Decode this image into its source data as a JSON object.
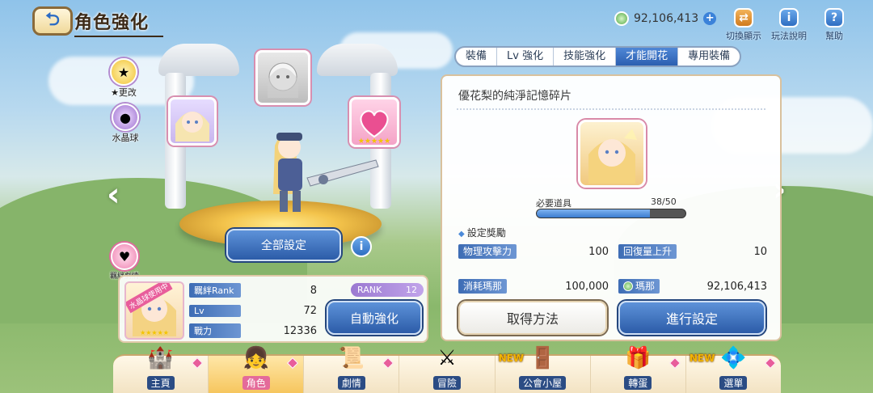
{
  "header": {
    "back_icon": "back-arrow-icon",
    "title": "角色強化",
    "currency": {
      "icon": "mana-coin-icon",
      "amount": "92,106,413"
    },
    "buttons": [
      {
        "icon": "switch-icon",
        "label": "切換顯示"
      },
      {
        "icon": "info-icon",
        "label": "玩法說明"
      },
      {
        "icon": "help-icon",
        "label": "幫助"
      }
    ]
  },
  "tabs": [
    {
      "label": "裝備"
    },
    {
      "label": "Lv 強化"
    },
    {
      "label": "技能強化"
    },
    {
      "label": "才能開花",
      "active": true
    },
    {
      "label": "專用裝備"
    }
  ],
  "left": {
    "side_icons": [
      {
        "icon": "star-change-icon",
        "label": "★更改"
      },
      {
        "icon": "crystal-ball-icon",
        "label": "水晶球"
      },
      {
        "icon": "heart-bond-icon",
        "label": "羈絆劇情"
      }
    ],
    "set_all_label": "全部設定",
    "status": {
      "crystal_tag": "水晶球使用中",
      "rows": [
        {
          "label": "羈絆Rank",
          "value": "8"
        },
        {
          "label": "Lv",
          "value": "72"
        },
        {
          "label": "戰力",
          "value": "12336"
        }
      ],
      "rank": {
        "label": "RANK",
        "value": "12"
      },
      "auto_enhance_label": "自動強化"
    }
  },
  "panel": {
    "item_title": "優花梨的純淨記憶碎片",
    "required_label": "必要道具",
    "required_count": "38/50",
    "progress": 0.76,
    "section_label": "設定獎勵",
    "rewards": [
      {
        "label": "物理攻擊力",
        "value": "100"
      },
      {
        "label": "回復量上升",
        "value": "10"
      }
    ],
    "cost": {
      "label": "消耗瑪那",
      "value": "100,000"
    },
    "owned": {
      "label": "瑪那",
      "value": "92,106,413"
    },
    "obtain_label": "取得方法",
    "confirm_label": "進行設定"
  },
  "bottom_nav": [
    {
      "icon": "castle-icon",
      "label": "主頁",
      "badge": true,
      "new": ""
    },
    {
      "icon": "character-icon",
      "label": "角色",
      "badge": true,
      "new": "",
      "active": true
    },
    {
      "icon": "scroll-icon",
      "label": "劇情",
      "badge": true,
      "new": ""
    },
    {
      "icon": "sword-shield-icon",
      "label": "冒險",
      "badge": false,
      "new": ""
    },
    {
      "icon": "guild-door-icon",
      "label": "公會小屋",
      "badge": false,
      "new": "NEW"
    },
    {
      "icon": "gacha-icon",
      "label": "轉蛋",
      "badge": true,
      "new": ""
    },
    {
      "icon": "menu-crystal-icon",
      "label": "選單",
      "badge": true,
      "new": "NEW"
    }
  ]
}
